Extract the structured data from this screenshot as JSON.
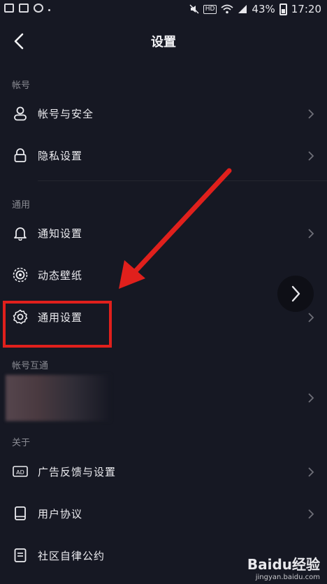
{
  "status_bar": {
    "network_badge": "HD",
    "battery": "43%",
    "time": "17:20"
  },
  "header": {
    "title": "设置"
  },
  "sections": {
    "account": {
      "label": "帐号",
      "items": [
        "帐号与安全",
        "隐私设置"
      ]
    },
    "general": {
      "label": "通用",
      "items": [
        "通知设置",
        "动态壁纸",
        "通用设置"
      ]
    },
    "linked": {
      "label": "帐号互通"
    },
    "about": {
      "label": "关于",
      "items": [
        "广告反馈与设置",
        "用户协议",
        "社区自律公约"
      ]
    }
  },
  "icons": {
    "ad": "AD"
  },
  "watermark": {
    "brand": "Baidu经验",
    "url": "jingyan.baidu.com"
  },
  "colors": {
    "background": "#161823",
    "annotation": "#e0201c",
    "muted_text": "#8a8b93"
  }
}
